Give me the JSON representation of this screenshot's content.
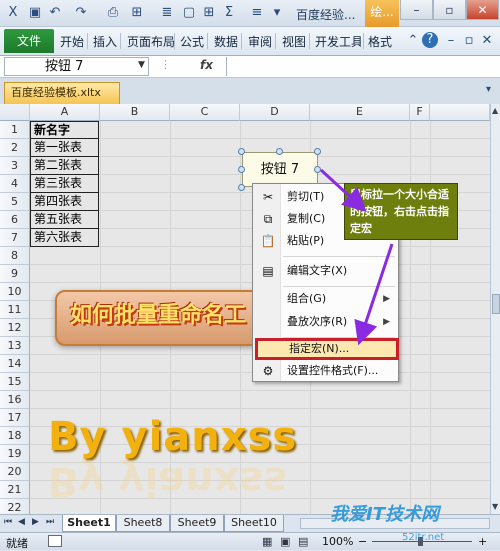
{
  "qat": {
    "title": "百度经验...",
    "ctx_tab": "绘..."
  },
  "ribbon": {
    "file": "文件",
    "tabs": [
      "开始",
      "插入",
      "页面布局",
      "公式",
      "数据",
      "审阅",
      "视图",
      "开发工具",
      "格式"
    ]
  },
  "formula_bar": {
    "name_box": "按钮 7",
    "fx": "fx",
    "value": ""
  },
  "doc_tab": "百度经验模板.xltx",
  "columns": [
    "A",
    "B",
    "C",
    "D",
    "E",
    "F"
  ],
  "rows": [
    "1",
    "2",
    "3",
    "4",
    "5",
    "6",
    "7",
    "8",
    "9",
    "10",
    "11",
    "12",
    "13",
    "14",
    "15",
    "16",
    "17",
    "18",
    "19",
    "20",
    "21",
    "22"
  ],
  "cells": [
    "新名字",
    "第一张表",
    "第二张表",
    "第三张表",
    "第四张表",
    "第五张表",
    "第六张表"
  ],
  "banner": "如何批量重命名工",
  "big_text": "By  yianxss",
  "form_button": "按钮 7",
  "callout": "鼠标拉一个大小合适的按钮，右击点击指定宏",
  "context_menu": [
    {
      "label": "剪切(T)",
      "icon": "scissors-icon"
    },
    {
      "label": "复制(C)",
      "icon": "copy-icon"
    },
    {
      "label": "粘贴(P)",
      "icon": "paste-icon"
    },
    {
      "label": "编辑文字(X)",
      "icon": "edit-text-icon"
    },
    {
      "label": "组合(G)",
      "icon": "",
      "submenu": true
    },
    {
      "label": "叠放次序(R)",
      "icon": "",
      "submenu": true
    },
    {
      "label": "指定宏(N)...",
      "icon": "",
      "highlight": true
    },
    {
      "label": "设置控件格式(F)...",
      "icon": "format-control-icon"
    }
  ],
  "sheets": [
    "Sheet1",
    "Sheet8",
    "Sheet9",
    "Sheet10"
  ],
  "status": {
    "mode": "就绪",
    "zoom": "100%"
  },
  "watermark": {
    "main": "我爱IT技术网",
    "url": "52itr.net"
  },
  "colors": {
    "accent": "#c8202a",
    "callout": "#6e7f0e",
    "file_tab": "#1d7a2c"
  }
}
